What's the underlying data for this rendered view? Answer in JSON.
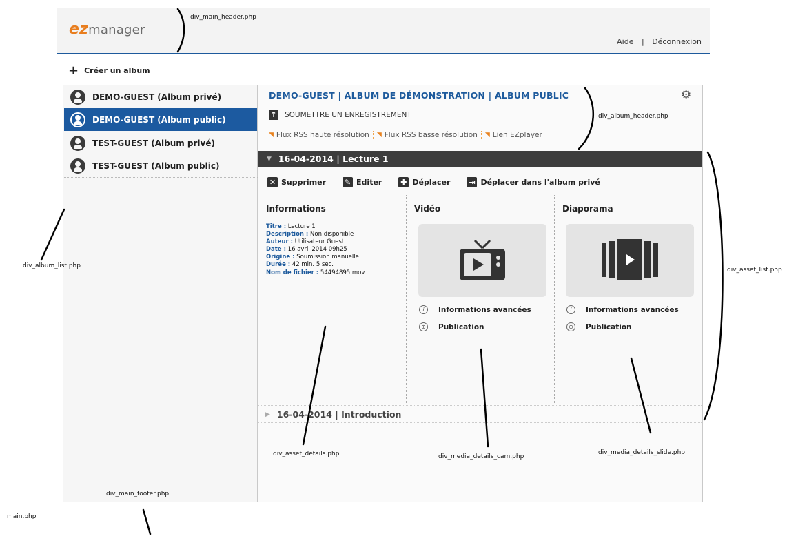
{
  "header": {
    "logo_ez": "ez",
    "logo_text": "manager",
    "help": "Aide",
    "separator": "|",
    "logout": "Déconnexion"
  },
  "create_album": "Créer un album",
  "albums": [
    {
      "label": "DEMO-GUEST (Album privé)",
      "active": false
    },
    {
      "label": "DEMO-GUEST (Album public)",
      "active": true
    },
    {
      "label": "TEST-GUEST (Album privé)",
      "active": false
    },
    {
      "label": "TEST-GUEST (Album public)",
      "active": false
    }
  ],
  "album_header": {
    "title": "DEMO-GUEST | ALBUM DE DÉMONSTRATION | ALBUM PUBLIC",
    "submit": "SOUMETTRE UN ENREGISTREMENT",
    "rss_hd": "Flux RSS haute résolution",
    "rss_ld": "Flux RSS basse résolution",
    "ezplayer": "Lien EZplayer"
  },
  "assets": [
    {
      "title": "16-04-2014 | Lecture 1",
      "expanded": true
    },
    {
      "title": "16-04-2014 | Introduction",
      "expanded": false
    }
  ],
  "actions": {
    "delete": "Supprimer",
    "edit": "Editer",
    "move": "Déplacer",
    "move_private": "Déplacer dans l'album privé"
  },
  "columns": {
    "info": "Informations",
    "video": "Vidéo",
    "slides": "Diaporama"
  },
  "info": [
    {
      "key": "Titre :",
      "value": " Lecture 1"
    },
    {
      "key": "Description :",
      "value": " Non disponible"
    },
    {
      "key": "Auteur :",
      "value": " Utilisateur Guest"
    },
    {
      "key": "Date :",
      "value": " 16 avril 2014 09h25"
    },
    {
      "key": "Origine :",
      "value": " Soumission manuelle"
    },
    {
      "key": "Durée :",
      "value": " 42 min. 5 sec."
    },
    {
      "key": "Nom de fichier :",
      "value": " 54494895.mov"
    }
  ],
  "media_links": {
    "advanced": "Informations avancées",
    "publication": "Publication"
  },
  "annotations": {
    "main_header": "div_main_header.php",
    "album_header": "div_album_header.php",
    "album_list": "div_album_list.php",
    "asset_list": "div_asset_list.php",
    "asset_details": "div_asset_details.php",
    "media_cam": "div_media_details_cam.php",
    "media_slide": "div_media_details_slide.php",
    "main_footer": "div_main_footer.php",
    "main": "main.php"
  },
  "colors": {
    "accent": "#1c5aa0",
    "logo_orange": "#e87d1e",
    "asset_bar": "#3d3d3d"
  }
}
